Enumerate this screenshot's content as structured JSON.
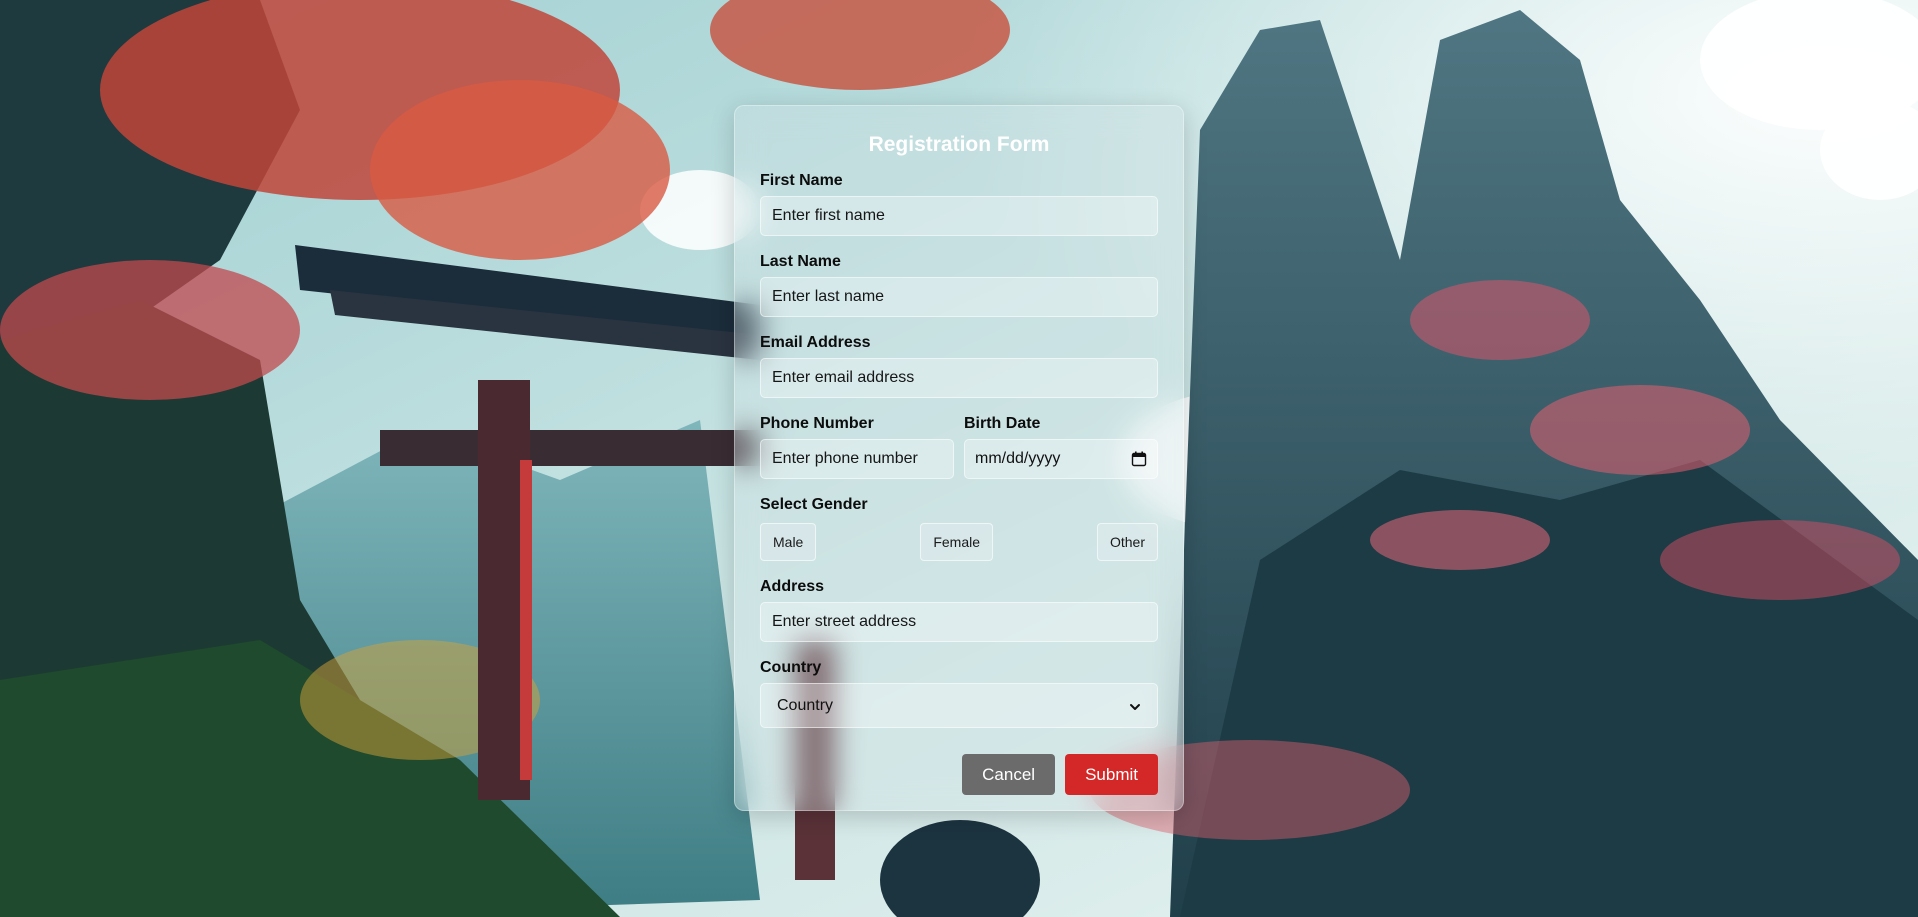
{
  "form": {
    "title": "Registration Form",
    "first_name": {
      "label": "First Name",
      "placeholder": "Enter first name",
      "value": ""
    },
    "last_name": {
      "label": "Last Name",
      "placeholder": "Enter last name",
      "value": ""
    },
    "email": {
      "label": "Email Address",
      "placeholder": "Enter email address",
      "value": ""
    },
    "phone": {
      "label": "Phone Number",
      "placeholder": "Enter phone number",
      "value": ""
    },
    "birth_date": {
      "label": "Birth Date",
      "value": "mm/dd/yyyy",
      "icon": "calendar-icon"
    },
    "gender": {
      "label": "Select Gender",
      "options": [
        "Male",
        "Female",
        "Other"
      ]
    },
    "address": {
      "label": "Address",
      "placeholder": "Enter street address",
      "value": ""
    },
    "country": {
      "label": "Country",
      "selected": "Country",
      "icon": "chevron-down-icon"
    },
    "buttons": {
      "cancel": "Cancel",
      "submit": "Submit"
    }
  },
  "colors": {
    "cancel_bg": "#6b6b6b",
    "submit_bg": "#d42828",
    "title_text": "#ffffff",
    "label_text": "#0c0c0c"
  },
  "background": {
    "scene": "anime-style landscape with torii gate, red maple trees and misty mountains"
  }
}
